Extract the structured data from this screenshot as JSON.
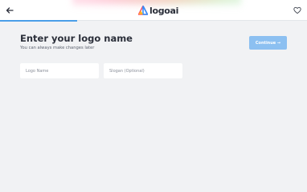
{
  "header": {
    "back_icon": "arrow-left-icon",
    "logo_icon": "triangle-logo-icon",
    "logo_text": "logoai",
    "favorite_icon": "heart-icon"
  },
  "progress": {
    "fraction": 0.25,
    "fill_color": "#4a9ee8"
  },
  "main": {
    "title": "Enter your logo name",
    "subtitle": "You can always make changes later",
    "continue_label": "Continue →",
    "logo_name_placeholder": "Logo Name",
    "logo_name_value": "",
    "slogan_placeholder": "Slogan (Optional)",
    "slogan_value": ""
  },
  "colors": {
    "background": "#f1f2f4",
    "button": "#8cc0f1",
    "title": "#2b2f3a"
  }
}
